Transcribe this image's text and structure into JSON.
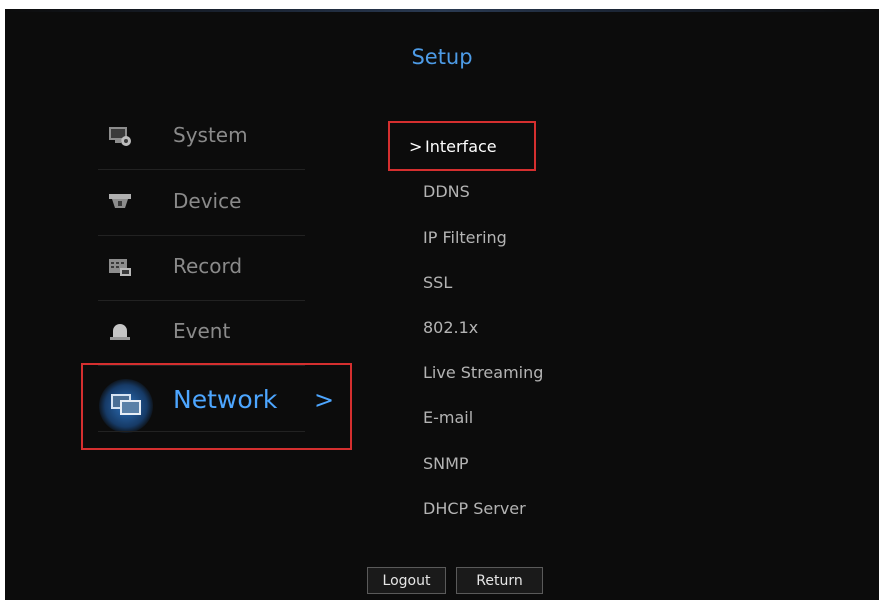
{
  "header": {
    "title": "Setup"
  },
  "menu": {
    "items": [
      {
        "label": "System",
        "icon": "system-icon"
      },
      {
        "label": "Device",
        "icon": "camera-icon"
      },
      {
        "label": "Record",
        "icon": "record-icon"
      },
      {
        "label": "Event",
        "icon": "alarm-icon"
      },
      {
        "label": "Network",
        "icon": "network-icon",
        "selected": true
      }
    ],
    "selected_chevron": ">"
  },
  "submenu": {
    "items": [
      {
        "label": "Interface",
        "selected": true
      },
      {
        "label": "DDNS"
      },
      {
        "label": "IP Filtering"
      },
      {
        "label": "SSL"
      },
      {
        "label": "802.1x"
      },
      {
        "label": "Live Streaming"
      },
      {
        "label": "E-mail"
      },
      {
        "label": "SNMP"
      },
      {
        "label": "DHCP Server"
      }
    ],
    "selected_prefix": ">"
  },
  "footer": {
    "logout_label": "Logout",
    "return_label": "Return"
  },
  "colors": {
    "accent": "#4da6ff",
    "highlight_box": "#d52f2f",
    "background": "#0c0c0c"
  }
}
